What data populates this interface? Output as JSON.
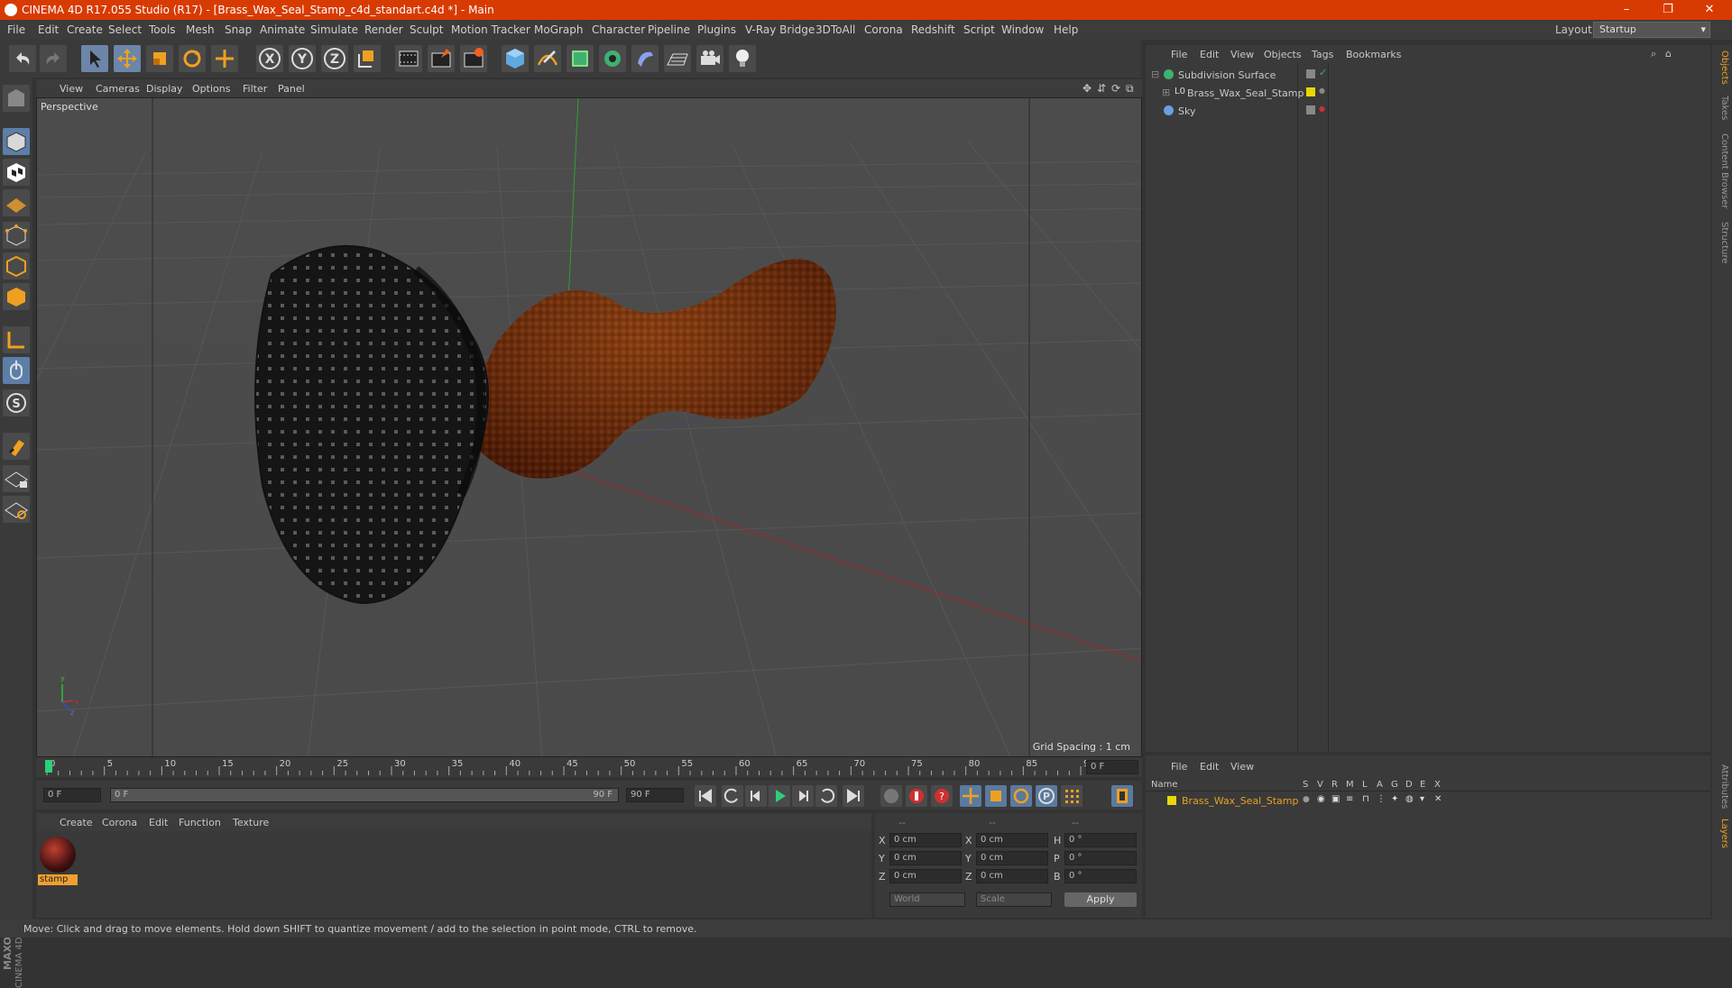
{
  "window": {
    "title": "CINEMA 4D R17.055 Studio (R17) - [Brass_Wax_Seal_Stamp_c4d_standart.c4d *] - Main",
    "minimize": "–",
    "maximize": "❐",
    "close": "✕"
  },
  "menubar": {
    "items": [
      "File",
      "Edit",
      "Create",
      "Select",
      "Tools",
      "Mesh",
      "Snap",
      "Animate",
      "Simulate",
      "Render",
      "Sculpt",
      "Motion Tracker",
      "MoGraph",
      "Character",
      "Pipeline",
      "Plugins",
      "V-Ray Bridge",
      "3DToAll",
      "Corona",
      "Redshift",
      "Script",
      "Window",
      "Help"
    ],
    "layout_label": "Layout:",
    "layout_value": "Startup"
  },
  "viewport": {
    "menu": [
      "View",
      "Cameras",
      "Display",
      "Options",
      "Filter",
      "Panel"
    ],
    "label": "Perspective",
    "grid_spacing": "Grid Spacing : 1 cm"
  },
  "timeline": {
    "ticks": [
      "0",
      "5",
      "10",
      "15",
      "20",
      "25",
      "30",
      "35",
      "40",
      "45",
      "50",
      "55",
      "60",
      "65",
      "70",
      "75",
      "80",
      "85",
      "90"
    ],
    "end_field": "0 F",
    "current_frame": "0 F",
    "range_start": "0 F",
    "range_end": "90 F",
    "max_frame": "90 F"
  },
  "material_manager": {
    "menu": [
      "Create",
      "Corona",
      "Edit",
      "Function",
      "Texture"
    ],
    "materials": [
      {
        "name": "stamp"
      }
    ]
  },
  "coordinates": {
    "header": [
      "--",
      "--",
      "--"
    ],
    "rows": [
      {
        "a": "X",
        "av": "0 cm",
        "b": "X",
        "bv": "0 cm",
        "c": "H",
        "cv": "0 °"
      },
      {
        "a": "Y",
        "av": "0 cm",
        "b": "Y",
        "bv": "0 cm",
        "c": "P",
        "cv": "0 °"
      },
      {
        "a": "Z",
        "av": "0 cm",
        "b": "Z",
        "bv": "0 cm",
        "c": "B",
        "cv": "0 °"
      }
    ],
    "mode1": "World",
    "mode2": "Scale",
    "apply": "Apply"
  },
  "object_manager": {
    "menu": [
      "File",
      "Edit",
      "View",
      "Objects",
      "Tags",
      "Bookmarks"
    ],
    "objects": [
      {
        "name": "Subdivision Surface"
      },
      {
        "name": "Brass_Wax_Seal_Stamp"
      },
      {
        "name": "Sky"
      }
    ]
  },
  "layer_manager": {
    "menu": [
      "File",
      "Edit",
      "View"
    ],
    "columns": [
      "Name",
      "S",
      "V",
      "R",
      "M",
      "L",
      "A",
      "G",
      "D",
      "E",
      "X"
    ],
    "layers": [
      {
        "name": "Brass_Wax_Seal_Stamp"
      }
    ]
  },
  "side_tabs": [
    "Objects",
    "Takes",
    "Content Browser",
    "Structure"
  ],
  "side_tabs_bottom": [
    "Attributes",
    "Layers"
  ],
  "status": "Move: Click and drag to move elements. Hold down SHIFT to quantize movement / add to the selection in point mode, CTRL to remove.",
  "brand": {
    "line1": "MAXON",
    "line2": "CINEMA 4D"
  },
  "colors": {
    "titlebar": "#d83b01",
    "accent_select": "#6b86a8",
    "layer_color": "#e8d800",
    "material_tag": "#f0a030"
  }
}
